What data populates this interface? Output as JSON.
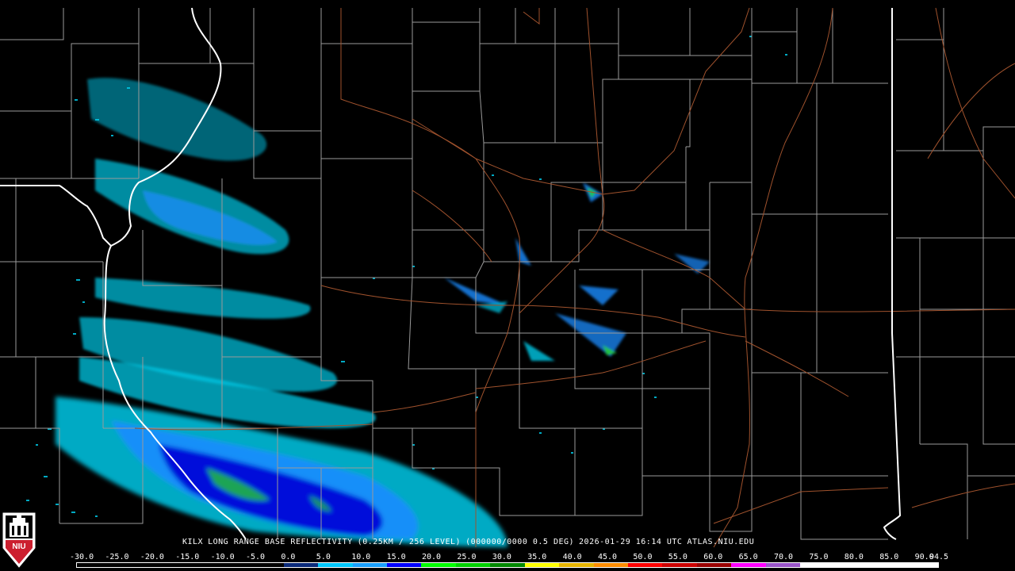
{
  "product": {
    "station": "KILX",
    "product_name": "LONG RANGE BASE REFLECTIVITY",
    "resolution": "(0.25KM / 256 LEVEL)",
    "volume": "(000000/0000 0.5 DEG)",
    "timestamp": "2026-01-29 16:14 UTC",
    "source": "ATLAS.NIU.EDU"
  },
  "logo": {
    "text": "NIU",
    "icon": "niu-tower-icon",
    "color": "#cc1f2f"
  },
  "scale": {
    "labels": [
      "-30.0",
      "-25.0",
      "-20.0",
      "-15.0",
      "-10.0",
      "-5.0",
      "0.0",
      "5.0",
      "10.0",
      "15.0",
      "20.0",
      "25.0",
      "30.0",
      "35.0",
      "40.0",
      "45.0",
      "50.0",
      "55.0",
      "60.0",
      "65.0",
      "70.0",
      "75.0",
      "80.0",
      "85.0",
      "90.0",
      "94.5"
    ],
    "colors": [
      "#000000",
      "#000000",
      "#000000",
      "#000000",
      "#000000",
      "#000000",
      "#0a2a7a",
      "#00c8ff",
      "#1aa0ff",
      "#0000ff",
      "#00ff00",
      "#00d000",
      "#008800",
      "#ffff00",
      "#e6b400",
      "#ff8c00",
      "#ff0000",
      "#cc0000",
      "#990000",
      "#ff00ff",
      "#9955c9",
      "#ffffff",
      "#ffffff",
      "#ffffff",
      "#ffffff"
    ]
  },
  "map_colors": {
    "background": "#000000",
    "county_lines": "#9a9a9a",
    "state_lines": "#ffffff",
    "highways": "#a0522d",
    "echo_light": "#00c8e6",
    "echo_medium": "#1a8cff",
    "echo_heavy": "#0000d8",
    "echo_green": "#22cc33"
  }
}
